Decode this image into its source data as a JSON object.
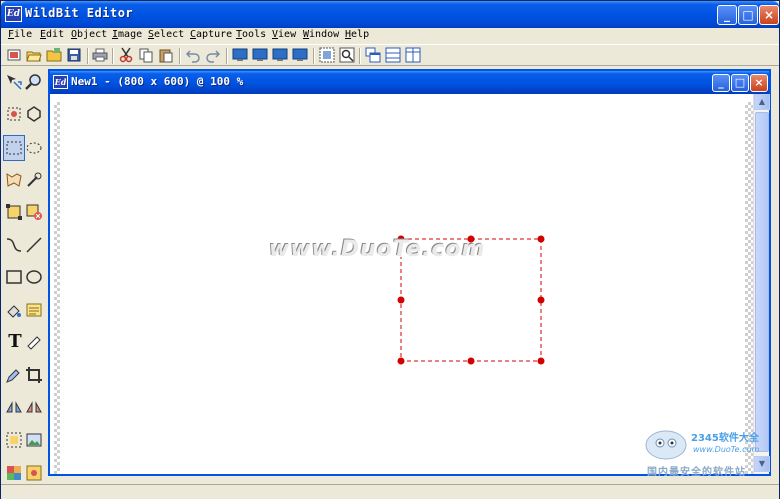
{
  "app": {
    "logo_text": "Ed",
    "title": "WildBit Editor",
    "minimize_glyph": "_",
    "maximize_glyph": "□",
    "close_glyph": "×"
  },
  "menu": [
    {
      "hot": "F",
      "rest": "ile"
    },
    {
      "hot": "E",
      "rest": "dit"
    },
    {
      "hot": "O",
      "rest": "bject"
    },
    {
      "hot": "I",
      "rest": "mage"
    },
    {
      "hot": "S",
      "rest": "elect"
    },
    {
      "hot": "C",
      "rest": "apture"
    },
    {
      "hot": "T",
      "rest": "ools"
    },
    {
      "hot": "V",
      "rest": "iew"
    },
    {
      "hot": "W",
      "rest": "indow"
    },
    {
      "hot": "H",
      "rest": "elp"
    }
  ],
  "toolbar_icons": [
    "new-image-icon",
    "open-icon",
    "open-folder-icon",
    "save-icon",
    "print-icon",
    "cut-icon",
    "copy-icon",
    "paste-icon",
    "undo-icon",
    "redo-icon",
    "monitor-icon",
    "monitor-icon",
    "monitor-icon",
    "monitor-icon",
    "zoom-fit-icon",
    "zoom-actual-icon",
    "cascade-icon",
    "tile-horizontal-icon",
    "tile-vertical-icon"
  ],
  "tools": [
    "move-icon",
    "zoom-icon",
    "point-select-icon",
    "polygon-icon",
    "rect-select-icon",
    "ellipse-select-icon",
    "lasso-icon",
    "magic-wand-icon",
    "crop-select-icon",
    "clear-select-icon",
    "curve-icon",
    "line-icon",
    "rectangle-icon",
    "ellipse-icon",
    "fill-icon",
    "note-icon",
    "text-icon",
    "eraser-icon",
    "eyedropper-icon",
    "crop-icon",
    "flip-h-icon",
    "flip-v-icon",
    "frame-icon",
    "image-icon",
    "palette-icon",
    "picture-icon"
  ],
  "document": {
    "logo_text": "Ed",
    "title": "New1 - (800 x 600) @ 100 %"
  },
  "watermark": "www.DuoTe.com",
  "corner_logo": {
    "brand": "2345软件大全",
    "url": "www.DuoTe.com",
    "tag": "国内最安全的软件站"
  },
  "colors": {
    "titlebar": "#0054e3",
    "selection": "#d40000",
    "face": "#ece9d8"
  }
}
